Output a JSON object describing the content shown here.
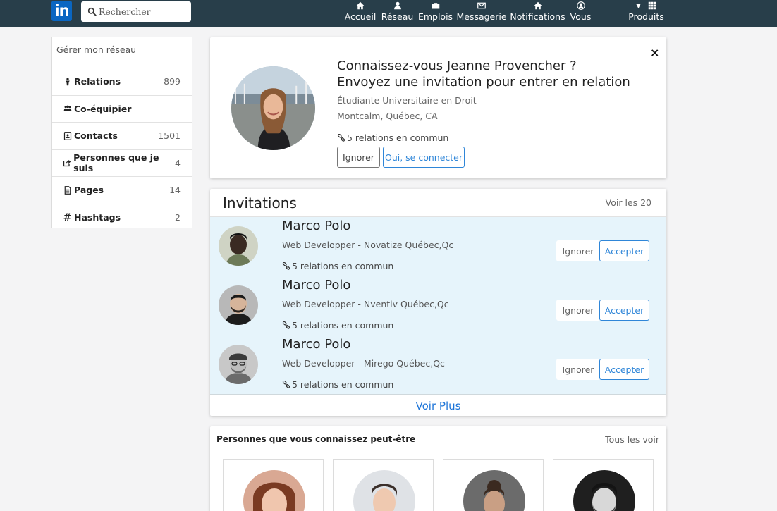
{
  "header": {
    "logo_text": "in",
    "search_placeholder": "Rechercher",
    "nav": [
      {
        "label": "Accueil",
        "icon": "home-icon"
      },
      {
        "label": "Réseau",
        "icon": "user-icon"
      },
      {
        "label": "Emplois",
        "icon": "briefcase-icon"
      },
      {
        "label": "Messagerie",
        "icon": "envelope-icon"
      },
      {
        "label": "Notifications",
        "icon": "home-icon"
      },
      {
        "label": "Vous",
        "icon": "user-circle-icon"
      },
      {
        "label": "Produits",
        "icon": "grid-icon"
      }
    ]
  },
  "sidebar": {
    "title": "Gérer mon réseau",
    "items": [
      {
        "label": "Relations",
        "count": "899",
        "icon": "person-icon"
      },
      {
        "label": "Co-équipier",
        "count": "",
        "icon": "users-icon"
      },
      {
        "label": "Contacts",
        "count": "1501",
        "icon": "address-book-icon"
      },
      {
        "label": "Personnes que je suis",
        "count": "4",
        "icon": "share-icon"
      },
      {
        "label": "Pages",
        "count": "14",
        "icon": "file-icon"
      },
      {
        "label": "Hashtags",
        "count": "2",
        "icon": "hashtag-icon"
      }
    ]
  },
  "suggestion": {
    "title": "Connaissez-vous Jeanne Provencher ? Envoyez une invitation pour entrer en relation",
    "subtitle": "Étudiante Universitaire en Droit",
    "location": "Montcalm, Québec, CA",
    "common": "5 relations en commun",
    "ignore_label": "Ignorer",
    "connect_label": "Oui, se connecter",
    "close_label": "×"
  },
  "invitations": {
    "title": "Invitations",
    "see_all": "Voir les 20",
    "rows": [
      {
        "name": "Marco Polo",
        "job": "Web Developper - Novatize Québec,Qc",
        "common": "5 relations en commun",
        "ignore": "Ignorer",
        "accept": "Accepter"
      },
      {
        "name": "Marco Polo",
        "job": "Web Developper - Nventiv Québec,Qc",
        "common": "5 relations en commun",
        "ignore": "Ignorer",
        "accept": "Accepter"
      },
      {
        "name": "Marco Polo",
        "job": "Web Developper - Mirego Québec,Qc",
        "common": "5 relations en commun",
        "ignore": "Ignorer",
        "accept": "Accepter"
      }
    ],
    "more": "Voir Plus"
  },
  "pymk": {
    "title": "Personnes que vous connaissez peut-être",
    "see_all": "Tous les voir"
  },
  "colors": {
    "topbar": "#283e4a",
    "accent": "#2f86d8",
    "invite_bg": "#e6f4fb"
  }
}
